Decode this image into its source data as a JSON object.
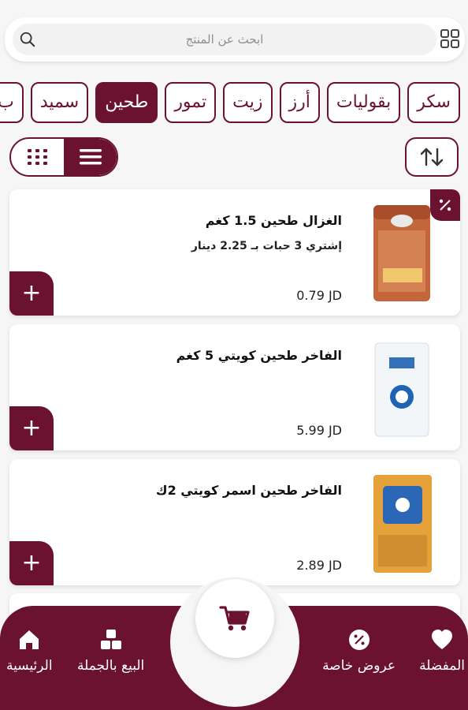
{
  "search": {
    "placeholder": "ابحث عن المنتج"
  },
  "categories": [
    "سكر",
    "بقوليات",
    "أرز",
    "زيت",
    "تمور",
    "طحين",
    "سميد",
    "ب"
  ],
  "active_category": "طحين",
  "products": [
    {
      "name": "الغزال طحين 1.5 كغم",
      "promo": "إشتري 3 حبات بـ 2.25 دينار",
      "price": "0.79 JD",
      "discount": true
    },
    {
      "name": "الفاخر طحين كويتي 5 كغم",
      "promo": "",
      "price": "5.99 JD",
      "discount": false
    },
    {
      "name": "الفاخر طحين اسمر كويتي 2ك",
      "promo": "",
      "price": "2.89 JD",
      "discount": false
    }
  ],
  "add_label": "+",
  "nav": {
    "favorites": "المفضلة",
    "offers": "عروض خاصة",
    "wholesale": "البيع بالجملة",
    "home": "الرئيسية"
  },
  "colors": {
    "brand": "#6b1230",
    "background": "#f6f6f6",
    "card": "#ffffff"
  },
  "icons": [
    "search-icon",
    "grid-icon",
    "list-icon",
    "sort-icon",
    "discount-icon",
    "cart-icon",
    "heart-icon",
    "percent-badge-icon",
    "boxes-icon",
    "home-icon"
  ]
}
